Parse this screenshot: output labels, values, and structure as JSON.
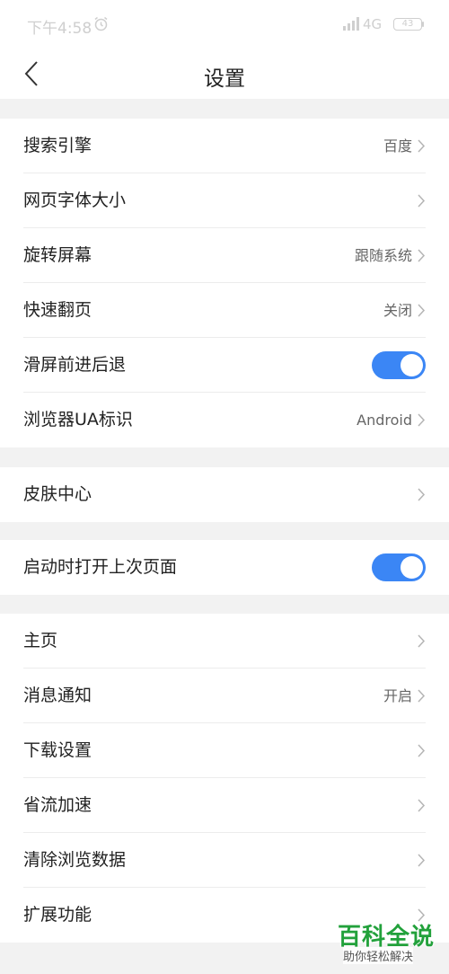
{
  "status_bar": {
    "time": "下午4:58",
    "network": "4G",
    "battery_level": "43"
  },
  "header": {
    "title": "设置"
  },
  "groups": [
    {
      "items": [
        {
          "label": "搜索引擎",
          "value": "百度",
          "control": "chevron"
        },
        {
          "label": "网页字体大小",
          "value": "",
          "control": "chevron"
        },
        {
          "label": "旋转屏幕",
          "value": "跟随系统",
          "control": "chevron"
        },
        {
          "label": "快速翻页",
          "value": "关闭",
          "control": "chevron"
        },
        {
          "label": "滑屏前进后退",
          "value": "",
          "control": "toggle",
          "toggle_on": true
        },
        {
          "label": "浏览器UA标识",
          "value": "Android",
          "control": "chevron"
        }
      ]
    },
    {
      "items": [
        {
          "label": "皮肤中心",
          "value": "",
          "control": "chevron"
        }
      ]
    },
    {
      "items": [
        {
          "label": "启动时打开上次页面",
          "value": "",
          "control": "toggle",
          "toggle_on": true
        }
      ]
    },
    {
      "items": [
        {
          "label": "主页",
          "value": "",
          "control": "chevron"
        },
        {
          "label": "消息通知",
          "value": "开启",
          "control": "chevron"
        },
        {
          "label": "下载设置",
          "value": "",
          "control": "chevron"
        },
        {
          "label": "省流加速",
          "value": "",
          "control": "chevron"
        },
        {
          "label": "清除浏览数据",
          "value": "",
          "control": "chevron"
        },
        {
          "label": "扩展功能",
          "value": "",
          "control": "chevron"
        }
      ]
    }
  ],
  "watermark": {
    "title": "百科全说",
    "subtitle": "助你轻松解决"
  },
  "colors": {
    "toggle_on": "#3b86f5",
    "watermark_green": "#22a13b"
  }
}
